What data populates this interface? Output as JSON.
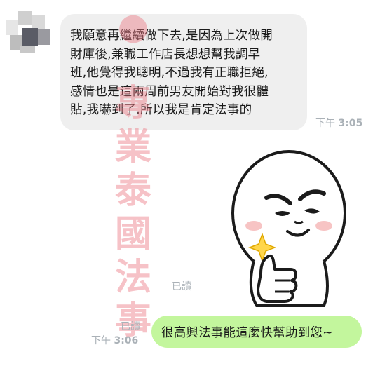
{
  "chat": {
    "incoming": {
      "lines": [
        "我願意再繼續做下去,是因為上次做開",
        "財庫後,兼職工作店長想想幫我調早",
        "班,他覺得我聰明,不過我有正職拒絕,",
        "感情也是這兩周前男友開始對我很體",
        "貼,我嚇到了.所以我是肯定法事的"
      ],
      "time_prefix": "下午",
      "time": "3:05"
    },
    "sticker": {
      "icon": "thumbs-up-smirk-sticker-icon",
      "read_label": "已讀"
    },
    "outgoing": {
      "text": "很高興法事能這麼快幫助到您~",
      "read_label": "已讀",
      "time_prefix": "下午",
      "time": "3:06"
    }
  },
  "watermark": {
    "chars": [
      "專",
      "業",
      "泰",
      "國",
      "法",
      "事"
    ]
  },
  "colors": {
    "incoming_bubble": "#efefef",
    "outgoing_bubble": "#c3f69d",
    "meta_text": "#aab1b7"
  }
}
